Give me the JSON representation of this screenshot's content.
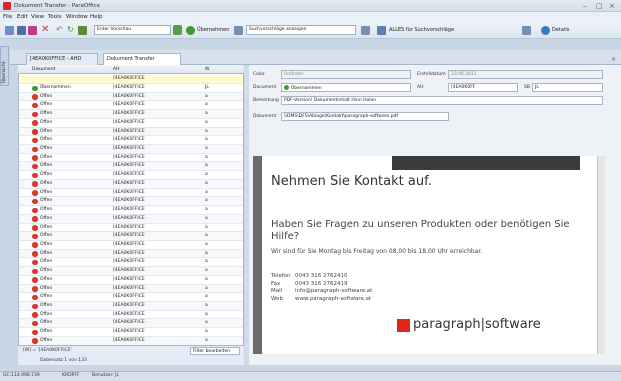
{
  "window": {
    "title": "Dokument Transfer - ParaOffice"
  },
  "menu": [
    "File",
    "Edit",
    "View",
    "Tools",
    "Window",
    "Help"
  ],
  "toolbar": {
    "select1": "Enter Vorschau",
    "btn_uebernehmen": "Übernehmen",
    "search_placeholder": "Suchvorschläge anzeigen",
    "all_label": "ALLES für Suchvorschläge",
    "details": "Details"
  },
  "vertical_tab": "Übersicht",
  "doc_tabs": [
    {
      "label": "[4EA0K0FFICE - AHD"
    },
    {
      "label": "Dokument Transfer"
    }
  ],
  "grid": {
    "headers": [
      "Dokument",
      "AH",
      "W"
    ],
    "first_row": {
      "ah": "[4EA0K0FFICE"
    },
    "rows": [
      {
        "status": "Übernommen",
        "ah": "[4EA0K0FFICE",
        "w": "JL"
      },
      {
        "status": "Offen",
        "ah": "[4EA0K0FFICE",
        "w": "a"
      },
      {
        "status": "Offen",
        "ah": "[4EA0K0FFICE",
        "w": "a"
      },
      {
        "status": "Offen",
        "ah": "[4EA0K0FFICE",
        "w": "a"
      },
      {
        "status": "Offen",
        "ah": "[4EA0K0FFICE",
        "w": "a"
      },
      {
        "status": "Offen",
        "ah": "[4EA0K0FFICE",
        "w": "a"
      },
      {
        "status": "Offen",
        "ah": "[4EA0K0FFICE",
        "w": "a"
      },
      {
        "status": "Offen",
        "ah": "[4EA0K0FFICE",
        "w": "a"
      },
      {
        "status": "Offen",
        "ah": "[4EA0K0FFICE",
        "w": "a"
      },
      {
        "status": "Offen",
        "ah": "[4EA0K0FFICE",
        "w": "a"
      },
      {
        "status": "Offen",
        "ah": "[4EA0K0FFICE",
        "w": "a"
      },
      {
        "status": "Offen",
        "ah": "[4EA0K0FFICE",
        "w": "a"
      },
      {
        "status": "Offen",
        "ah": "[4EA0K0FFICE",
        "w": "a"
      },
      {
        "status": "Offen",
        "ah": "[4EA0K0FFICE",
        "w": "a"
      },
      {
        "status": "Offen",
        "ah": "[4EA0K0FFICE",
        "w": "a"
      },
      {
        "status": "Offen",
        "ah": "[4EA0K0FFICE",
        "w": "a"
      },
      {
        "status": "Offen",
        "ah": "[4EA0K0FFICE",
        "w": "a"
      },
      {
        "status": "Offen",
        "ah": "[4EA0K0FFICE",
        "w": "a"
      },
      {
        "status": "Offen",
        "ah": "[4EA0K0FFICE",
        "w": "a"
      },
      {
        "status": "Offen",
        "ah": "[4EA0K0FFICE",
        "w": "a"
      },
      {
        "status": "Offen",
        "ah": "[4EA0K0FFICE",
        "w": "a"
      },
      {
        "status": "Offen",
        "ah": "[4EA0K0FFICE",
        "w": "a"
      },
      {
        "status": "Offen",
        "ah": "[4EA0K0FFICE",
        "w": "a"
      },
      {
        "status": "Offen",
        "ah": "[4EA0K0FFICE",
        "w": "a"
      },
      {
        "status": "Offen",
        "ah": "[4EA0K0FFICE",
        "w": "a"
      },
      {
        "status": "Offen",
        "ah": "[4EA0K0FFICE",
        "w": "a"
      },
      {
        "status": "Offen",
        "ah": "[4EA0K0FFICE",
        "w": "a"
      },
      {
        "status": "Offen",
        "ah": "[4EA0K0FFICE",
        "w": "a"
      },
      {
        "status": "Offen",
        "ah": "[4EA0K0FFICE",
        "w": "a"
      },
      {
        "status": "Offen",
        "ah": "[4EA0K0FFICE",
        "w": "a"
      }
    ],
    "filter_text": "[W] = '[4EA0K0FFICE'",
    "filter_button": "Filter bearbeiten",
    "nav_text": "Datensatz 1 von 133"
  },
  "form": {
    "color_label": "Color",
    "color_value": "Unfinder",
    "erstelldatum_label": "Erstelldatum",
    "erstelldatum_value": "23.06.2011",
    "document_label": "Document",
    "status_value": "Übernommen",
    "ah_label": "AH",
    "ah_value": "[4EA0K0FF",
    "sb_label": "SB",
    "sb_value": "JL",
    "bemerkung_label": "Bemerkung",
    "bemerkung_value": "PDF-Version! Dokumentinhalt Hinn Holen",
    "dokument_label": "Dokument",
    "dokument_value": "\\\\DMS\\DFS\\Ablage\\Kontakt\\paragraph-software.pdf"
  },
  "preview": {
    "heading": "Nehmen Sie Kontakt auf.",
    "subheading": "Haben Sie Fragen zu unseren Produkten oder benötigen Sie Hilfe?",
    "hours": "Wir sind für Sie Montag bis Freitag von 08.00 bis 18.00 Uhr erreichbar.",
    "contact": [
      {
        "label": "Telefon",
        "value": "0043 316 2762410"
      },
      {
        "label": "Fax",
        "value": "0043 316 2762419"
      },
      {
        "label": "Mail",
        "value": "info@paragraph-software.at"
      },
      {
        "label": "Web",
        "value": "www.paragraph-software.at"
      }
    ],
    "logo": "paragraph|software"
  },
  "statusbar": {
    "left": "GC:114.998.739",
    "mid": "KROPFF",
    "right": "Benutzer: JL"
  },
  "colors": {
    "accent": "#e1261c",
    "ok": "#3c9a2f",
    "open": "#d33a2a"
  }
}
